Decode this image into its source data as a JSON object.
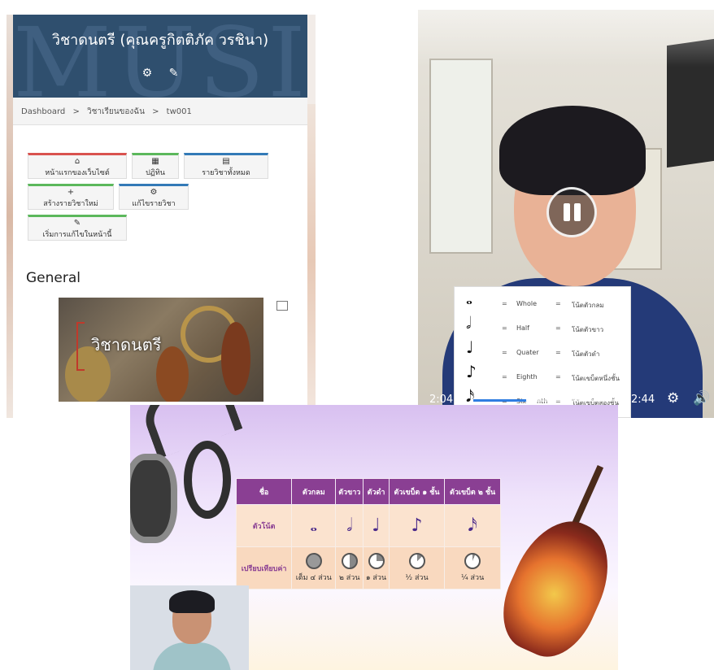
{
  "course_page": {
    "watermark": "MUSIC",
    "title": "วิชาดนตรี (คุณครูกิตติภัค วรชินา)",
    "header_icons": [
      "gear-icon",
      "pencil-icon"
    ],
    "breadcrumb": [
      "Dashboard",
      ">",
      "วิชาเรียนของฉัน",
      ">",
      "tw001"
    ],
    "buttons": [
      {
        "label": "หน้าแรกของเว็บไซต์",
        "icon": "home-icon"
      },
      {
        "label": "ปฏิทิน",
        "icon": "calendar-icon"
      },
      {
        "label": "รายวิชาทั้งหมด",
        "icon": "courses-icon"
      },
      {
        "label": "สร้างรายวิชาใหม่",
        "icon": "plus-icon"
      },
      {
        "label": "แก้ไขรายวิชา",
        "icon": "gear-icon"
      },
      {
        "label": "เริ่มการแก้ไขในหน้านี้",
        "icon": "pencil-icon"
      }
    ],
    "section_title": "General",
    "course_image_label": "วิชาดนตรี"
  },
  "video_player": {
    "notes": [
      {
        "glyph": "𝅝",
        "eq1": "=",
        "english": "Whole",
        "eq2": "=",
        "thai": "โน้ตตัวกลม"
      },
      {
        "glyph": "𝅗𝅥",
        "eq1": "=",
        "english": "Half",
        "eq2": "=",
        "thai": "โน้ตตัวขาว"
      },
      {
        "glyph": "♩",
        "eq1": "=",
        "english": "Quater",
        "eq2": "=",
        "thai": "โน้ตตัวดำ"
      },
      {
        "glyph": "♪",
        "eq1": "=",
        "english": "Eighth",
        "eq2": "=",
        "thai": "โน้ตเขบ็ตหนึ่งชั้น"
      },
      {
        "glyph": "𝅘𝅥𝅯",
        "eq1": "=",
        "english": "Sixteenth",
        "eq2": "=",
        "thai": "โน้ตเขบ็ตสองชั้น"
      }
    ],
    "current_time": "2:04",
    "duration": "2:44",
    "progress": 0.4,
    "controls": [
      "pause-icon",
      "settings-icon",
      "volume-icon"
    ]
  },
  "lesson_slide": {
    "table": {
      "headers": [
        "ชื่อ",
        "ตัวกลม",
        "ตัวขาว",
        "ตัวดำ",
        "ตัวเขบ็ต ๑ ชั้น",
        "ตัวเขบ็ต ๒ ชั้น"
      ],
      "row1_label": "ตัวโน้ต",
      "row1_glyphs": [
        "𝅝",
        "𝅗𝅥",
        "♩",
        "♪",
        "𝅘𝅥𝅯"
      ],
      "row2_label": "เปรียบเทียบค่า",
      "row2_values": [
        "เต็ม ๔ ส่วน",
        "๒ ส่วน",
        "๑ ส่วน",
        "½ ส่วน",
        "¼ ส่วน"
      ]
    }
  },
  "colors": {
    "moodle_header": "#2f4f6e",
    "slide_header": "#8a3f93",
    "progress": "#2f7de1"
  }
}
